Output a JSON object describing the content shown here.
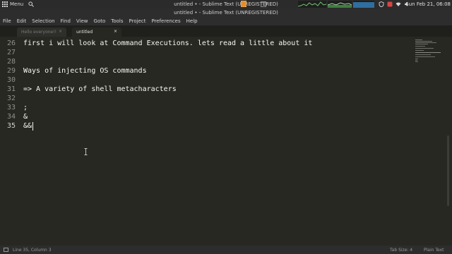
{
  "system_panel": {
    "menu_label": "Menu",
    "clock": "Sun Feb 21, 06:08"
  },
  "window": {
    "title": "untitled • - Sublime Text (UNREGISTERED)"
  },
  "menubar": {
    "items": [
      "File",
      "Edit",
      "Selection",
      "Find",
      "View",
      "Goto",
      "Tools",
      "Project",
      "Preferences",
      "Help"
    ]
  },
  "tabs": [
    {
      "label": "Hello everyone!!",
      "close": "×",
      "active": false
    },
    {
      "label": "untitled",
      "close": "×",
      "active": true
    }
  ],
  "editor": {
    "lines": [
      {
        "number": "26",
        "text": "first i will look at Command Executions. lets read a little about it"
      },
      {
        "number": "27",
        "text": ""
      },
      {
        "number": "28",
        "text": ""
      },
      {
        "number": "29",
        "text": "Ways of injecting OS commands"
      },
      {
        "number": "30",
        "text": ""
      },
      {
        "number": "31",
        "text": "=> A variety of shell metacharacters"
      },
      {
        "number": "32",
        "text": ""
      },
      {
        "number": "33",
        "text": ";"
      },
      {
        "number": "34",
        "text": "&"
      },
      {
        "number": "35",
        "text": "&&"
      }
    ]
  },
  "statusbar": {
    "position": "Line 35, Column 3",
    "tab_size": "Tab Size: 4",
    "syntax": "Plain Text"
  },
  "colors": {
    "editor_bg": "#272822",
    "text": "#f8f8f2",
    "line_numbers": "#8f908a",
    "active_tab_icon": "#e58e26"
  }
}
